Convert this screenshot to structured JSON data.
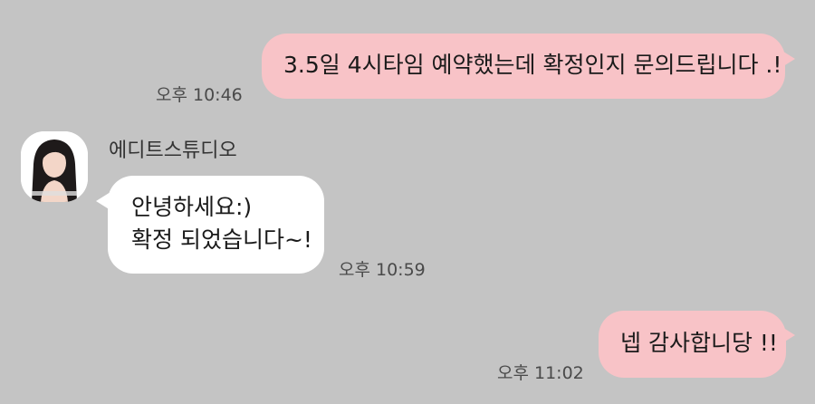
{
  "chat": {
    "messages": [
      {
        "side": "mine",
        "text": "3.5일 4시타임 예약했는데 확정인지 문의드립니다 .!",
        "time": "오후 10:46"
      },
      {
        "side": "theirs",
        "sender": "에디트스튜디오",
        "lines": [
          "안녕하세요:)",
          "확정 되었습니다~!"
        ],
        "time": "오후 10:59"
      },
      {
        "side": "mine",
        "text": "넵 감사합니당 !!",
        "time": "오후 11:02"
      }
    ]
  },
  "colors": {
    "background": "#c4c4c4",
    "my_bubble": "#f8c3c7",
    "their_bubble": "#ffffff"
  },
  "icons": {
    "avatar": "profile-photo-icon"
  }
}
